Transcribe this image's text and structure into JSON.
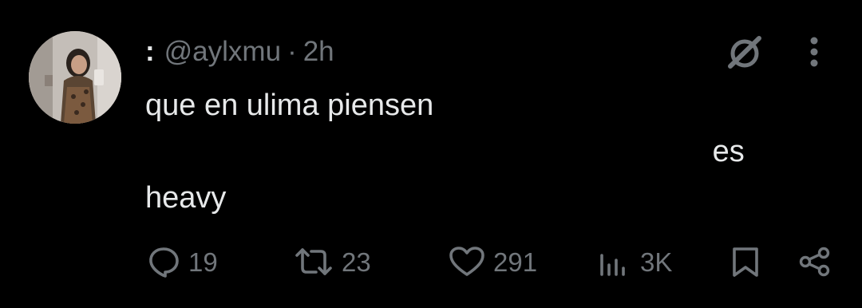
{
  "tweet": {
    "display_name": ":",
    "handle": "@aylxmu",
    "separator": "·",
    "time": "2h",
    "text_line1": "que en ulima piensen",
    "text_line2_end": "es",
    "text_line3": "heavy"
  },
  "actions": {
    "replies": "19",
    "reposts": "23",
    "likes": "291",
    "views": "3K"
  },
  "icons": {
    "avatar": "avatar",
    "grok": "grok-icon",
    "more": "more-vertical-icon",
    "reply": "reply-icon",
    "repost": "repost-icon",
    "like": "heart-icon",
    "views": "views-chart-icon",
    "bookmark": "bookmark-icon",
    "share": "share-icon"
  },
  "colors": {
    "background": "#000000",
    "text": "#e7e9ea",
    "secondary": "#71767b"
  }
}
